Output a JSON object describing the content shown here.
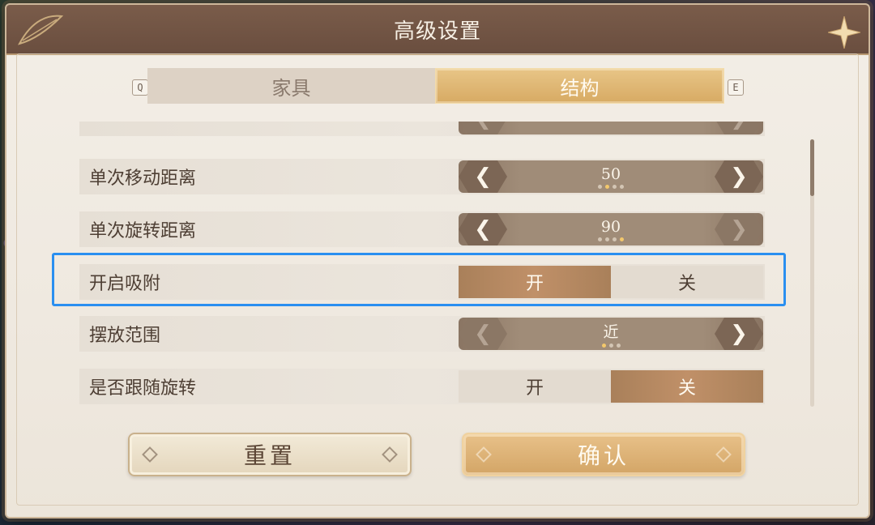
{
  "dialog": {
    "title": "高级设置"
  },
  "tabs": {
    "prev_key": "Q",
    "next_key": "E",
    "items": [
      {
        "label": "家具",
        "selected": false
      },
      {
        "label": "结构",
        "selected": true
      }
    ]
  },
  "settings": {
    "move_distance": {
      "label": "单次移动距离",
      "value": "50",
      "level": 2,
      "total": 4
    },
    "rotate_distance": {
      "label": "单次旋转距离",
      "value": "90",
      "level": 4,
      "total": 4
    },
    "snap": {
      "label": "开启吸附",
      "on_label": "开",
      "off_label": "关",
      "selected": "开"
    },
    "place_range": {
      "label": "摆放范围",
      "value": "近",
      "level": 1,
      "total": 3
    },
    "follow_rotation": {
      "label": "是否跟随旋转",
      "on_label": "开",
      "off_label": "关",
      "selected": "关"
    }
  },
  "footer": {
    "reset_label": "重置",
    "confirm_label": "确认"
  },
  "colors": {
    "accent": "#d7aa63",
    "highlight": "#2a8ff0",
    "header": "#6a4e3f"
  }
}
